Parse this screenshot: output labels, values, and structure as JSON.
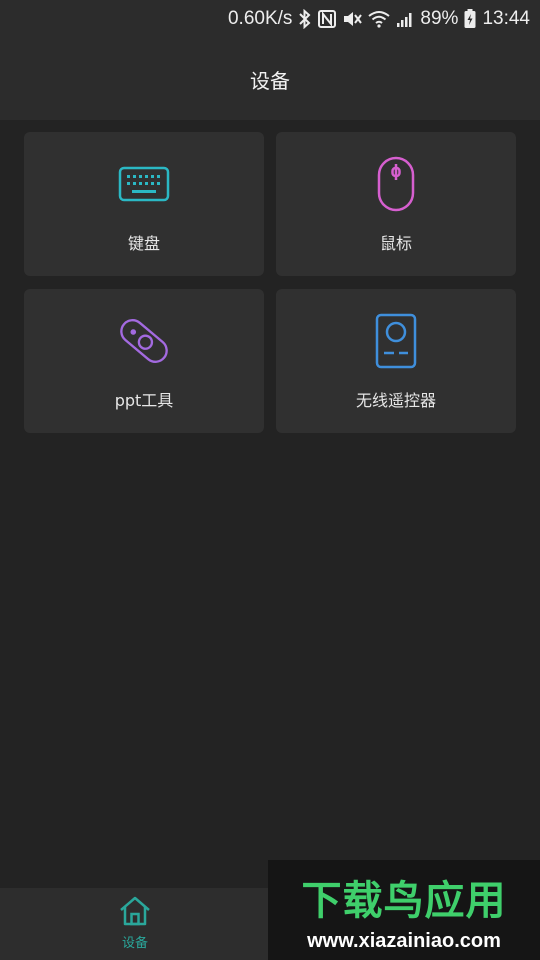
{
  "status_bar": {
    "net_speed": "0.60K/s",
    "battery": "89%",
    "time": "13:44",
    "icons": [
      "bluetooth-icon",
      "nfc-icon",
      "mute-icon",
      "wifi-icon",
      "signal-icon",
      "battery-charging-icon"
    ]
  },
  "header": {
    "title": "设备"
  },
  "devices": [
    {
      "label": "键盘",
      "icon": "keyboard-icon",
      "color": "#2bb8c4"
    },
    {
      "label": "鼠标",
      "icon": "mouse-icon",
      "color": "#d65fcf"
    },
    {
      "label": "ppt工具",
      "icon": "ppt-remote-icon",
      "color": "#a36ae0"
    },
    {
      "label": "无线遥控器",
      "icon": "remote-control-icon",
      "color": "#3f8fdc"
    }
  ],
  "bottom_nav": {
    "items": [
      {
        "label": "设备",
        "icon": "home-icon",
        "active": true,
        "color": "#2aa79b"
      }
    ]
  },
  "watermark": {
    "logo": "下载鸟应用",
    "url": "www.xiazainiao.com"
  }
}
